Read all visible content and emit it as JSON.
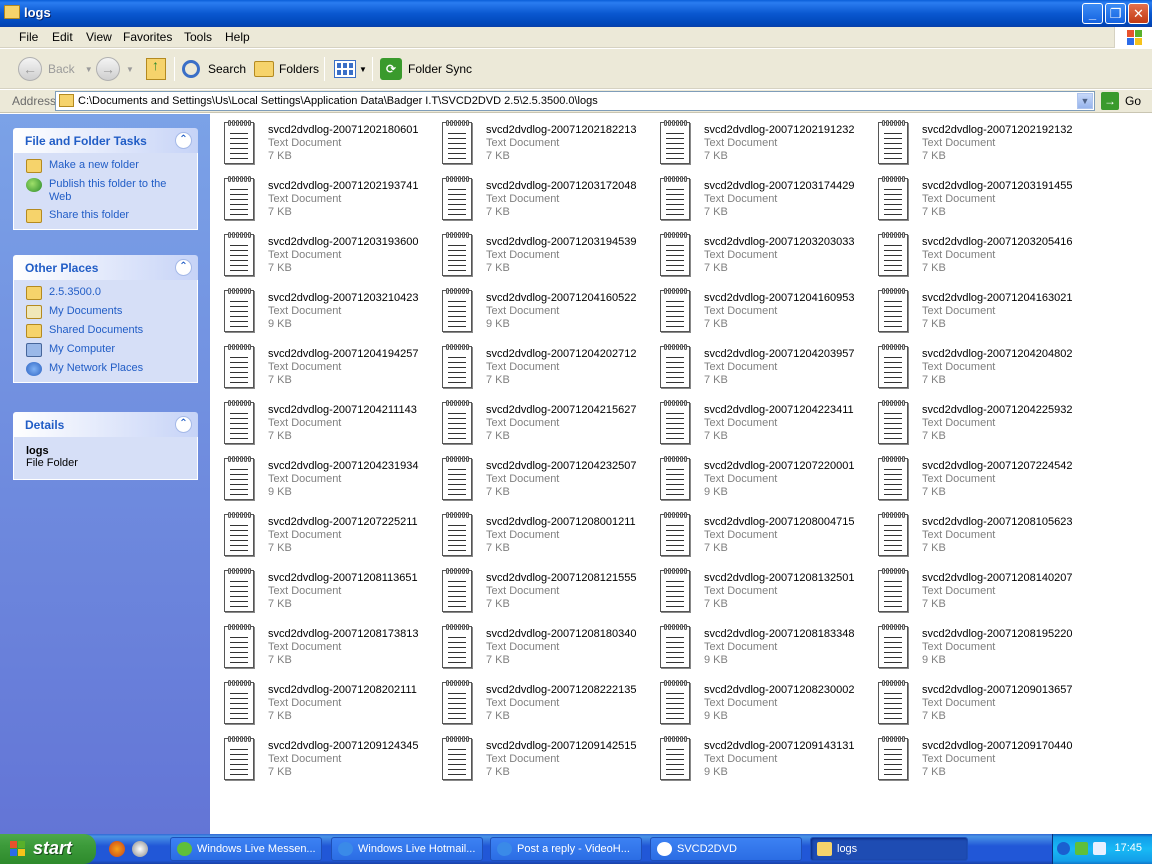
{
  "window": {
    "title": "logs"
  },
  "menu": [
    "File",
    "Edit",
    "View",
    "Favorites",
    "Tools",
    "Help"
  ],
  "toolbar": {
    "back_label": "Back",
    "search_label": "Search",
    "folders_label": "Folders",
    "foldersync_label": "Folder Sync"
  },
  "address": {
    "label": "Address",
    "value": "C:\\Documents and Settings\\Us\\Local Settings\\Application Data\\Badger I.T\\SVCD2DVD 2.5\\2.5.3500.0\\logs",
    "go_label": "Go"
  },
  "left": {
    "tasks_title": "File and Folder Tasks",
    "tasks": [
      "Make a new folder",
      "Publish this folder to the Web",
      "Share this folder"
    ],
    "places_title": "Other Places",
    "places": [
      "2.5.3500.0",
      "My Documents",
      "Shared Documents",
      "My Computer",
      "My Network Places"
    ],
    "details_title": "Details",
    "details_name": "logs",
    "details_type": "File Folder"
  },
  "files": [
    {
      "name": "svcd2dvdlog-20071202180601",
      "type": "Text Document",
      "size": "7 KB"
    },
    {
      "name": "svcd2dvdlog-20071202182213",
      "type": "Text Document",
      "size": "7 KB"
    },
    {
      "name": "svcd2dvdlog-20071202191232",
      "type": "Text Document",
      "size": "7 KB"
    },
    {
      "name": "svcd2dvdlog-20071202192132",
      "type": "Text Document",
      "size": "7 KB"
    },
    {
      "name": "svcd2dvdlog-20071202193741",
      "type": "Text Document",
      "size": "7 KB"
    },
    {
      "name": "svcd2dvdlog-20071203172048",
      "type": "Text Document",
      "size": "7 KB"
    },
    {
      "name": "svcd2dvdlog-20071203174429",
      "type": "Text Document",
      "size": "7 KB"
    },
    {
      "name": "svcd2dvdlog-20071203191455",
      "type": "Text Document",
      "size": "7 KB"
    },
    {
      "name": "svcd2dvdlog-20071203193600",
      "type": "Text Document",
      "size": "7 KB"
    },
    {
      "name": "svcd2dvdlog-20071203194539",
      "type": "Text Document",
      "size": "7 KB"
    },
    {
      "name": "svcd2dvdlog-20071203203033",
      "type": "Text Document",
      "size": "7 KB"
    },
    {
      "name": "svcd2dvdlog-20071203205416",
      "type": "Text Document",
      "size": "7 KB"
    },
    {
      "name": "svcd2dvdlog-20071203210423",
      "type": "Text Document",
      "size": "9 KB"
    },
    {
      "name": "svcd2dvdlog-20071204160522",
      "type": "Text Document",
      "size": "9 KB"
    },
    {
      "name": "svcd2dvdlog-20071204160953",
      "type": "Text Document",
      "size": "7 KB"
    },
    {
      "name": "svcd2dvdlog-20071204163021",
      "type": "Text Document",
      "size": "7 KB"
    },
    {
      "name": "svcd2dvdlog-20071204194257",
      "type": "Text Document",
      "size": "7 KB"
    },
    {
      "name": "svcd2dvdlog-20071204202712",
      "type": "Text Document",
      "size": "7 KB"
    },
    {
      "name": "svcd2dvdlog-20071204203957",
      "type": "Text Document",
      "size": "7 KB"
    },
    {
      "name": "svcd2dvdlog-20071204204802",
      "type": "Text Document",
      "size": "7 KB"
    },
    {
      "name": "svcd2dvdlog-20071204211143",
      "type": "Text Document",
      "size": "7 KB"
    },
    {
      "name": "svcd2dvdlog-20071204215627",
      "type": "Text Document",
      "size": "7 KB"
    },
    {
      "name": "svcd2dvdlog-20071204223411",
      "type": "Text Document",
      "size": "7 KB"
    },
    {
      "name": "svcd2dvdlog-20071204225932",
      "type": "Text Document",
      "size": "7 KB"
    },
    {
      "name": "svcd2dvdlog-20071204231934",
      "type": "Text Document",
      "size": "9 KB"
    },
    {
      "name": "svcd2dvdlog-20071204232507",
      "type": "Text Document",
      "size": "7 KB"
    },
    {
      "name": "svcd2dvdlog-20071207220001",
      "type": "Text Document",
      "size": "9 KB"
    },
    {
      "name": "svcd2dvdlog-20071207224542",
      "type": "Text Document",
      "size": "7 KB"
    },
    {
      "name": "svcd2dvdlog-20071207225211",
      "type": "Text Document",
      "size": "7 KB"
    },
    {
      "name": "svcd2dvdlog-20071208001211",
      "type": "Text Document",
      "size": "7 KB"
    },
    {
      "name": "svcd2dvdlog-20071208004715",
      "type": "Text Document",
      "size": "7 KB"
    },
    {
      "name": "svcd2dvdlog-20071208105623",
      "type": "Text Document",
      "size": "7 KB"
    },
    {
      "name": "svcd2dvdlog-20071208113651",
      "type": "Text Document",
      "size": "7 KB"
    },
    {
      "name": "svcd2dvdlog-20071208121555",
      "type": "Text Document",
      "size": "7 KB"
    },
    {
      "name": "svcd2dvdlog-20071208132501",
      "type": "Text Document",
      "size": "7 KB"
    },
    {
      "name": "svcd2dvdlog-20071208140207",
      "type": "Text Document",
      "size": "7 KB"
    },
    {
      "name": "svcd2dvdlog-20071208173813",
      "type": "Text Document",
      "size": "7 KB"
    },
    {
      "name": "svcd2dvdlog-20071208180340",
      "type": "Text Document",
      "size": "7 KB"
    },
    {
      "name": "svcd2dvdlog-20071208183348",
      "type": "Text Document",
      "size": "9 KB"
    },
    {
      "name": "svcd2dvdlog-20071208195220",
      "type": "Text Document",
      "size": "9 KB"
    },
    {
      "name": "svcd2dvdlog-20071208202111",
      "type": "Text Document",
      "size": "7 KB"
    },
    {
      "name": "svcd2dvdlog-20071208222135",
      "type": "Text Document",
      "size": "7 KB"
    },
    {
      "name": "svcd2dvdlog-20071208230002",
      "type": "Text Document",
      "size": "9 KB"
    },
    {
      "name": "svcd2dvdlog-20071209013657",
      "type": "Text Document",
      "size": "7 KB"
    },
    {
      "name": "svcd2dvdlog-20071209124345",
      "type": "Text Document",
      "size": "7 KB"
    },
    {
      "name": "svcd2dvdlog-20071209142515",
      "type": "Text Document",
      "size": "7 KB"
    },
    {
      "name": "svcd2dvdlog-20071209143131",
      "type": "Text Document",
      "size": "9 KB"
    },
    {
      "name": "svcd2dvdlog-20071209170440",
      "type": "Text Document",
      "size": "7 KB"
    }
  ],
  "taskbar": {
    "start_label": "start",
    "tasks": [
      {
        "label": "Windows Live Messen...",
        "icon": "messenger-icon"
      },
      {
        "label": "Windows Live Hotmail...",
        "icon": "ie-icon"
      },
      {
        "label": "Post a reply - VideoH...",
        "icon": "ie-icon"
      },
      {
        "label": "SVCD2DVD",
        "icon": "svcd2dvd-icon"
      },
      {
        "label": "logs",
        "icon": "folder-icon"
      }
    ],
    "clock": "17:45"
  },
  "colors": {
    "titlebar": "#0a58d0",
    "leftpane": "#7ba2e7",
    "link": "#215dc6",
    "start": "#3c9a3a"
  }
}
